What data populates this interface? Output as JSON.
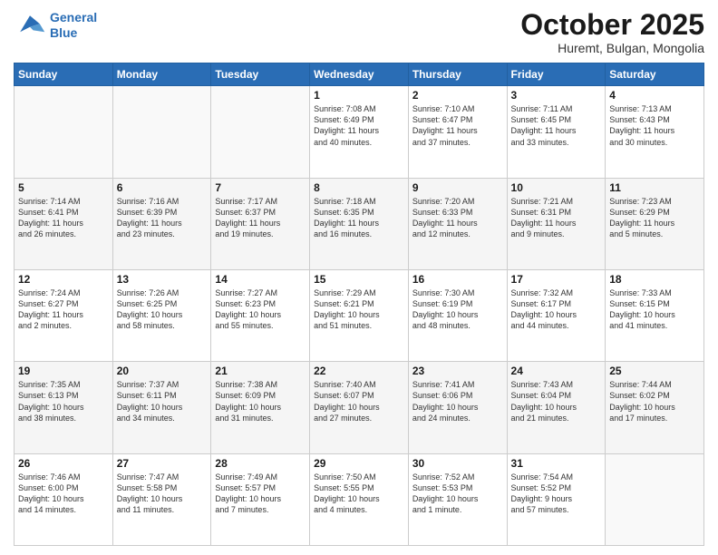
{
  "header": {
    "logo_line1": "General",
    "logo_line2": "Blue",
    "month": "October 2025",
    "location": "Huremt, Bulgan, Mongolia"
  },
  "weekdays": [
    "Sunday",
    "Monday",
    "Tuesday",
    "Wednesday",
    "Thursday",
    "Friday",
    "Saturday"
  ],
  "weeks": [
    [
      {
        "day": "",
        "info": ""
      },
      {
        "day": "",
        "info": ""
      },
      {
        "day": "",
        "info": ""
      },
      {
        "day": "1",
        "info": "Sunrise: 7:08 AM\nSunset: 6:49 PM\nDaylight: 11 hours\nand 40 minutes."
      },
      {
        "day": "2",
        "info": "Sunrise: 7:10 AM\nSunset: 6:47 PM\nDaylight: 11 hours\nand 37 minutes."
      },
      {
        "day": "3",
        "info": "Sunrise: 7:11 AM\nSunset: 6:45 PM\nDaylight: 11 hours\nand 33 minutes."
      },
      {
        "day": "4",
        "info": "Sunrise: 7:13 AM\nSunset: 6:43 PM\nDaylight: 11 hours\nand 30 minutes."
      }
    ],
    [
      {
        "day": "5",
        "info": "Sunrise: 7:14 AM\nSunset: 6:41 PM\nDaylight: 11 hours\nand 26 minutes."
      },
      {
        "day": "6",
        "info": "Sunrise: 7:16 AM\nSunset: 6:39 PM\nDaylight: 11 hours\nand 23 minutes."
      },
      {
        "day": "7",
        "info": "Sunrise: 7:17 AM\nSunset: 6:37 PM\nDaylight: 11 hours\nand 19 minutes."
      },
      {
        "day": "8",
        "info": "Sunrise: 7:18 AM\nSunset: 6:35 PM\nDaylight: 11 hours\nand 16 minutes."
      },
      {
        "day": "9",
        "info": "Sunrise: 7:20 AM\nSunset: 6:33 PM\nDaylight: 11 hours\nand 12 minutes."
      },
      {
        "day": "10",
        "info": "Sunrise: 7:21 AM\nSunset: 6:31 PM\nDaylight: 11 hours\nand 9 minutes."
      },
      {
        "day": "11",
        "info": "Sunrise: 7:23 AM\nSunset: 6:29 PM\nDaylight: 11 hours\nand 5 minutes."
      }
    ],
    [
      {
        "day": "12",
        "info": "Sunrise: 7:24 AM\nSunset: 6:27 PM\nDaylight: 11 hours\nand 2 minutes."
      },
      {
        "day": "13",
        "info": "Sunrise: 7:26 AM\nSunset: 6:25 PM\nDaylight: 10 hours\nand 58 minutes."
      },
      {
        "day": "14",
        "info": "Sunrise: 7:27 AM\nSunset: 6:23 PM\nDaylight: 10 hours\nand 55 minutes."
      },
      {
        "day": "15",
        "info": "Sunrise: 7:29 AM\nSunset: 6:21 PM\nDaylight: 10 hours\nand 51 minutes."
      },
      {
        "day": "16",
        "info": "Sunrise: 7:30 AM\nSunset: 6:19 PM\nDaylight: 10 hours\nand 48 minutes."
      },
      {
        "day": "17",
        "info": "Sunrise: 7:32 AM\nSunset: 6:17 PM\nDaylight: 10 hours\nand 44 minutes."
      },
      {
        "day": "18",
        "info": "Sunrise: 7:33 AM\nSunset: 6:15 PM\nDaylight: 10 hours\nand 41 minutes."
      }
    ],
    [
      {
        "day": "19",
        "info": "Sunrise: 7:35 AM\nSunset: 6:13 PM\nDaylight: 10 hours\nand 38 minutes."
      },
      {
        "day": "20",
        "info": "Sunrise: 7:37 AM\nSunset: 6:11 PM\nDaylight: 10 hours\nand 34 minutes."
      },
      {
        "day": "21",
        "info": "Sunrise: 7:38 AM\nSunset: 6:09 PM\nDaylight: 10 hours\nand 31 minutes."
      },
      {
        "day": "22",
        "info": "Sunrise: 7:40 AM\nSunset: 6:07 PM\nDaylight: 10 hours\nand 27 minutes."
      },
      {
        "day": "23",
        "info": "Sunrise: 7:41 AM\nSunset: 6:06 PM\nDaylight: 10 hours\nand 24 minutes."
      },
      {
        "day": "24",
        "info": "Sunrise: 7:43 AM\nSunset: 6:04 PM\nDaylight: 10 hours\nand 21 minutes."
      },
      {
        "day": "25",
        "info": "Sunrise: 7:44 AM\nSunset: 6:02 PM\nDaylight: 10 hours\nand 17 minutes."
      }
    ],
    [
      {
        "day": "26",
        "info": "Sunrise: 7:46 AM\nSunset: 6:00 PM\nDaylight: 10 hours\nand 14 minutes."
      },
      {
        "day": "27",
        "info": "Sunrise: 7:47 AM\nSunset: 5:58 PM\nDaylight: 10 hours\nand 11 minutes."
      },
      {
        "day": "28",
        "info": "Sunrise: 7:49 AM\nSunset: 5:57 PM\nDaylight: 10 hours\nand 7 minutes."
      },
      {
        "day": "29",
        "info": "Sunrise: 7:50 AM\nSunset: 5:55 PM\nDaylight: 10 hours\nand 4 minutes."
      },
      {
        "day": "30",
        "info": "Sunrise: 7:52 AM\nSunset: 5:53 PM\nDaylight: 10 hours\nand 1 minute."
      },
      {
        "day": "31",
        "info": "Sunrise: 7:54 AM\nSunset: 5:52 PM\nDaylight: 9 hours\nand 57 minutes."
      },
      {
        "day": "",
        "info": ""
      }
    ]
  ]
}
